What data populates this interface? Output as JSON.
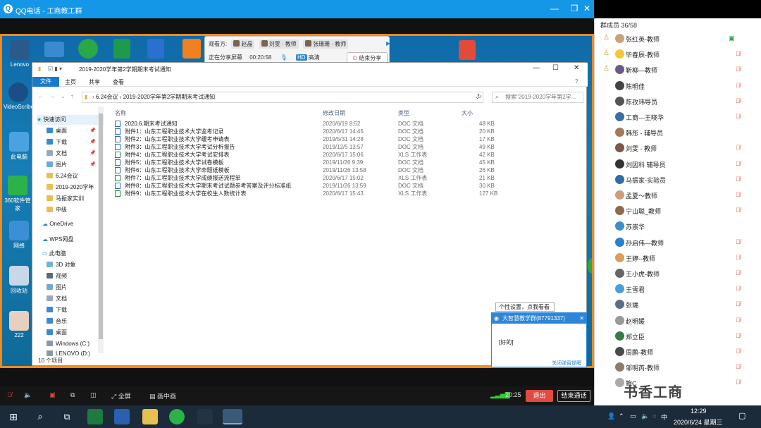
{
  "qq": {
    "title": "QQ电话 - 工商教工群"
  },
  "desktop_icons": [
    {
      "label": "Lenovo"
    },
    {
      "label": "VideoScribe"
    },
    {
      "label": "此电脑"
    },
    {
      "label": "360软件管家"
    },
    {
      "label": "网络"
    },
    {
      "label": "回收站"
    },
    {
      "label": "222"
    }
  ],
  "share": {
    "viewers_label": "观看方:",
    "viewers": [
      "赵晶",
      "刘雯 · 教师",
      "张珊珊 · 教师"
    ],
    "sharing_label": "正在分享屏幕",
    "elapsed": "00:20:58",
    "hd_badge": "HD",
    "hd_label": "高清",
    "stop_label": "结束分享"
  },
  "explorer": {
    "window_title": "2019-2020学年第2学期期末考试通知",
    "tabs": {
      "file": "文件",
      "home": "主页",
      "share": "共享",
      "view": "查看"
    },
    "path": [
      "6.24会议",
      "2019-2020学年第2学期期末考试通知"
    ],
    "search_placeholder": "搜索\"2019-2020学年第2学...",
    "nav": {
      "quick_access": "快速访问",
      "desktop": "桌面",
      "downloads": "下载",
      "documents": "文档",
      "pictures": "图片",
      "f1": "6.24会议",
      "f2": "2019-2020学年",
      "f3": "马振家实训",
      "f4": "中级",
      "onedrive": "OneDrive",
      "wps": "WPS网盘",
      "this_pc": "此电脑",
      "objects3d": "3D 对象",
      "videos": "视频",
      "pictures2": "图片",
      "documents2": "文档",
      "downloads2": "下载",
      "music": "音乐",
      "desktop2": "桌面",
      "windows_c": "Windows (C:)",
      "lenovo_d": "LENOVO (D:)"
    },
    "columns": {
      "name": "名称",
      "date": "修改日期",
      "type": "类型",
      "size": "大小"
    },
    "files": [
      {
        "name": "2020.6.期末考试通知",
        "date": "2020/6/19 8:52",
        "type": "DOC 文档",
        "size": "48 KB",
        "xls": false
      },
      {
        "name": "附件1：山东工程职业技术大学监考记录",
        "date": "2020/6/17 14:45",
        "type": "DOC 文档",
        "size": "20 KB",
        "xls": false
      },
      {
        "name": "附件2：山东工程职业技术大学缓考申请表",
        "date": "2019/5/31 14:28",
        "type": "DOC 文档",
        "size": "17 KB",
        "xls": false
      },
      {
        "name": "附件3：山东工程职业技术大学考试分析报告",
        "date": "2019/12/5 13:57",
        "type": "DOC 文档",
        "size": "49 KB",
        "xls": false
      },
      {
        "name": "附件4：山东工程职业技术大学考试安排表",
        "date": "2020/6/17 15:06",
        "type": "XLS 工作表",
        "size": "42 KB",
        "xls": true
      },
      {
        "name": "附件5：山东工程职业技术大学试卷模板",
        "date": "2019/11/26 9:39",
        "type": "DOC 文档",
        "size": "45 KB",
        "xls": false
      },
      {
        "name": "附件6：山东工程职业技术大学命题纸模板",
        "date": "2019/11/26 13:58",
        "type": "DOC 文档",
        "size": "26 KB",
        "xls": false
      },
      {
        "name": "附件7：山东工程职业技术大学成绩报送流程单",
        "date": "2020/6/17 15:02",
        "type": "XLS 工作表",
        "size": "21 KB",
        "xls": true
      },
      {
        "name": "附件8：山东工程职业技术大学期末考试试题参考答案及评分标准纸",
        "date": "2019/11/26 13:59",
        "type": "DOC 文档",
        "size": "30 KB",
        "xls": false
      },
      {
        "name": "附件9：山东工程职业技术大学在校生人数统计表",
        "date": "2020/6/17 15:43",
        "type": "XLS 工作表",
        "size": "127 KB",
        "xls": true
      }
    ],
    "status": "10 个项目"
  },
  "chat_popup": {
    "tip": "个性设置，点我看看",
    "title": "大智慧教学群(87791337)",
    "message": "[好的]",
    "link": "关闭弹窗提醒"
  },
  "members": {
    "header": "群成员 36/58",
    "list": [
      {
        "name": "张红英-教师",
        "color": "#c9a27a",
        "admin": true,
        "state": "mic"
      },
      {
        "name": "毕春辰-教师",
        "color": "#f2c838",
        "admin": true,
        "state": "mute"
      },
      {
        "name": "靳柳—教师",
        "color": "#6a5a8a",
        "admin": true,
        "state": "mute"
      },
      {
        "name": "陈明佳",
        "color": "#444",
        "admin": false,
        "state": "mute"
      },
      {
        "name": "陈孜玮导员",
        "color": "#555",
        "admin": false,
        "state": "mute"
      },
      {
        "name": "工商—王晓华",
        "color": "#3a6fa0",
        "admin": false,
        "state": "mute"
      },
      {
        "name": "韩彤 - 辅导员",
        "color": "#a27b5c",
        "admin": false,
        "state": ""
      },
      {
        "name": "刘雯 - 教师",
        "color": "#7b5a4a",
        "admin": false,
        "state": "mute"
      },
      {
        "name": "刘因科 辅导员",
        "color": "#333",
        "admin": false,
        "state": "mute"
      },
      {
        "name": "马振家-实验员",
        "color": "#2f6da3",
        "admin": false,
        "state": "mute"
      },
      {
        "name": "孟夏～教师",
        "color": "#caa07a",
        "admin": false,
        "state": "mute"
      },
      {
        "name": "宁山聪_教师",
        "color": "#8b6a4f",
        "admin": false,
        "state": "mute"
      },
      {
        "name": "苏崇华",
        "color": "#3c8fc9",
        "admin": false,
        "state": ""
      },
      {
        "name": "孙启伟—教师",
        "color": "#2b7fd0",
        "admin": false,
        "state": "mute"
      },
      {
        "name": "王婷--教师",
        "color": "#d8a05b",
        "admin": false,
        "state": "mute"
      },
      {
        "name": "王小虎-教师",
        "color": "#666",
        "admin": false,
        "state": "mute"
      },
      {
        "name": "王雪君",
        "color": "#4a9ed8",
        "admin": false,
        "state": "mute"
      },
      {
        "name": "张端",
        "color": "#5a6e85",
        "admin": false,
        "state": "mute"
      },
      {
        "name": "赵明媛",
        "color": "#9a9a9a",
        "admin": false,
        "state": "mute"
      },
      {
        "name": "郑立臣",
        "color": "#3a7a4a",
        "admin": false,
        "state": "mute"
      },
      {
        "name": "周鹏-教师",
        "color": "#4a4a4a",
        "admin": false,
        "state": "mute"
      },
      {
        "name": "邹明芮-教师",
        "color": "#8b7b6a",
        "admin": false,
        "state": "mute"
      },
      {
        "name": "鲍C",
        "color": "#aaa",
        "admin": false,
        "state": "mute"
      }
    ]
  },
  "callbar": {
    "fullscreen": "全屏",
    "pip": "画中画",
    "duration": "20:25",
    "hangup": "退出",
    "end": "结束通话"
  },
  "watermark": "书香工商",
  "taskbar": {
    "time": "12:29",
    "date": "2020/6/24 星期三",
    "ime": "中"
  }
}
